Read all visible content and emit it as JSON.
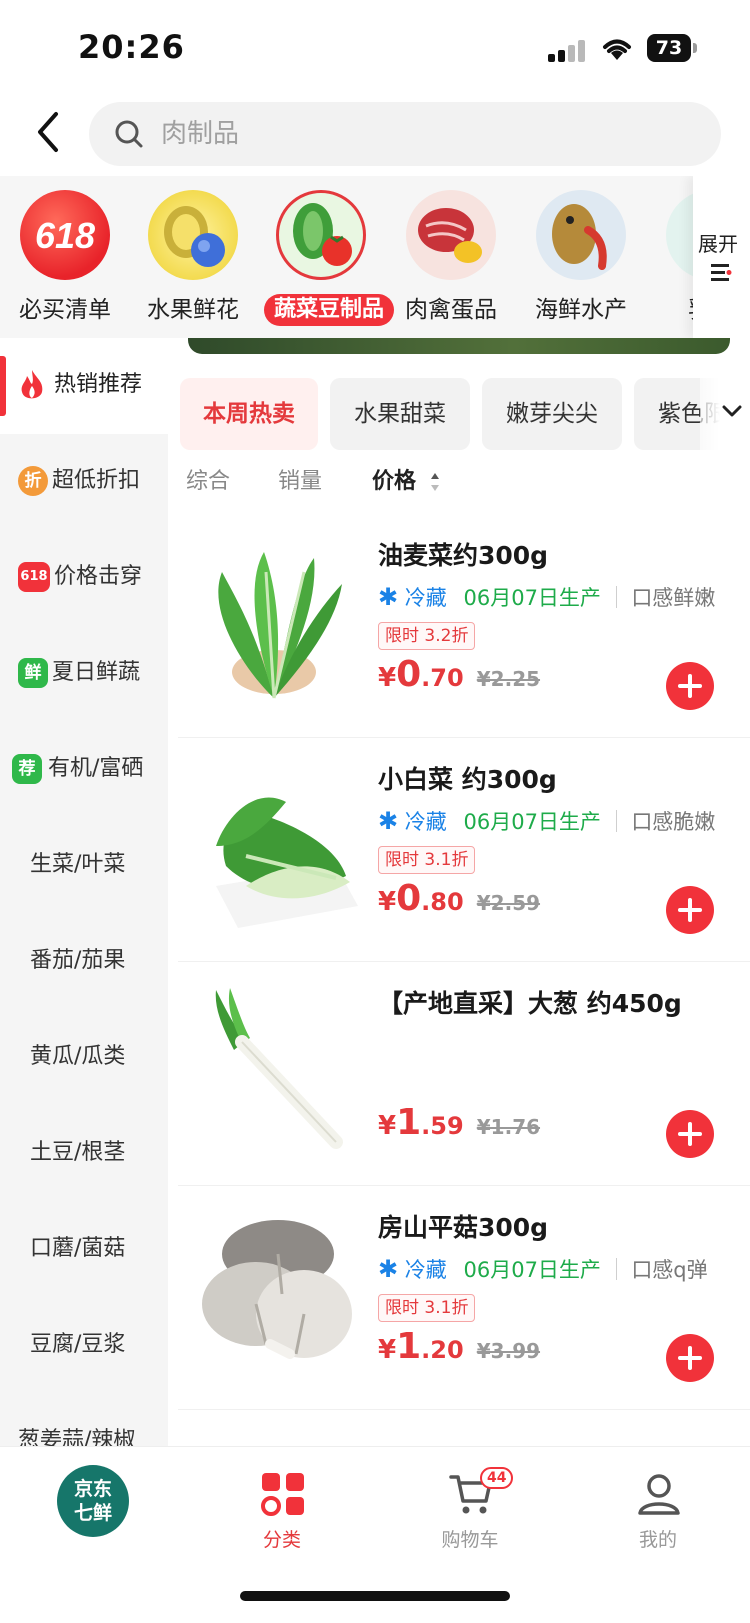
{
  "status_bar": {
    "time": "20:26",
    "battery": "73"
  },
  "search": {
    "placeholder": "肉制品"
  },
  "categories": [
    {
      "label": "必买清单",
      "icon": "618-promo-icon"
    },
    {
      "label": "水果鲜花",
      "icon": "durian-flower-image"
    },
    {
      "label": "蔬菜豆制品",
      "icon": "vegetable-image",
      "active": true
    },
    {
      "label": "肉禽蛋品",
      "icon": "meat-egg-image"
    },
    {
      "label": "海鲜水产",
      "icon": "fish-lobster-image"
    },
    {
      "label": "乳品",
      "icon": "dairy-image"
    }
  ],
  "expand": {
    "label": "展开"
  },
  "sidebar": {
    "items": [
      {
        "label": "热销推荐",
        "active": true,
        "badge_icon": "flame-icon"
      },
      {
        "label": "超低折扣",
        "badge": "折"
      },
      {
        "label": "价格击穿",
        "badge": "618"
      },
      {
        "label": "夏日鲜蔬",
        "badge": "鲜"
      },
      {
        "label": "有机/富硒",
        "badge": "荐"
      },
      {
        "label": "生菜/叶菜"
      },
      {
        "label": "番茄/茄果"
      },
      {
        "label": "黄瓜/瓜类"
      },
      {
        "label": "土豆/根茎"
      },
      {
        "label": "口蘑/菌菇"
      },
      {
        "label": "豆腐/豆浆"
      },
      {
        "label": "葱姜蒜/辣椒"
      }
    ]
  },
  "tags": [
    "本周热卖",
    "水果甜菜",
    "嫩芽尖尖",
    "紫色限定"
  ],
  "sort": {
    "overall": "综合",
    "sales": "销量",
    "price": "价格"
  },
  "products": [
    {
      "name": "油麦菜约300g",
      "cold": "冷藏",
      "date": "06月07日生产",
      "taste": "口感鲜嫩",
      "discount": "限时 3.2折",
      "price_yen": "¥",
      "price_int": "0",
      "price_dec": ".70",
      "price_old": "¥2.25",
      "image": "lettuce-image"
    },
    {
      "name": "小白菜 约300g",
      "cold": "冷藏",
      "date": "06月07日生产",
      "taste": "口感脆嫩",
      "discount": "限时 3.1折",
      "price_yen": "¥",
      "price_int": "0",
      "price_dec": ".80",
      "price_old": "¥2.59",
      "image": "bok-choy-image"
    },
    {
      "name": "【产地直采】大葱 约450g",
      "cold": "",
      "date": "",
      "taste": "",
      "discount": "",
      "price_yen": "¥",
      "price_int": "1",
      "price_dec": ".59",
      "price_old": "¥1.76",
      "image": "scallion-image"
    },
    {
      "name": "房山平菇300g",
      "cold": "冷藏",
      "date": "06月07日生产",
      "taste": "口感q弹",
      "discount": "限时 3.1折",
      "price_yen": "¥",
      "price_int": "1",
      "price_dec": ".20",
      "price_old": "¥3.99",
      "image": "oyster-mushroom-image"
    }
  ],
  "tabbar": {
    "logo": "京东七鲜",
    "logo_line1": "京东",
    "logo_line2": "七鲜",
    "category": "分类",
    "cart": "购物车",
    "cart_count": "44",
    "mine": "我的"
  },
  "colors": {
    "accent": "#f1323a",
    "cold": "#1a82e6",
    "date": "#1eab4a",
    "brand": "#16766a"
  }
}
